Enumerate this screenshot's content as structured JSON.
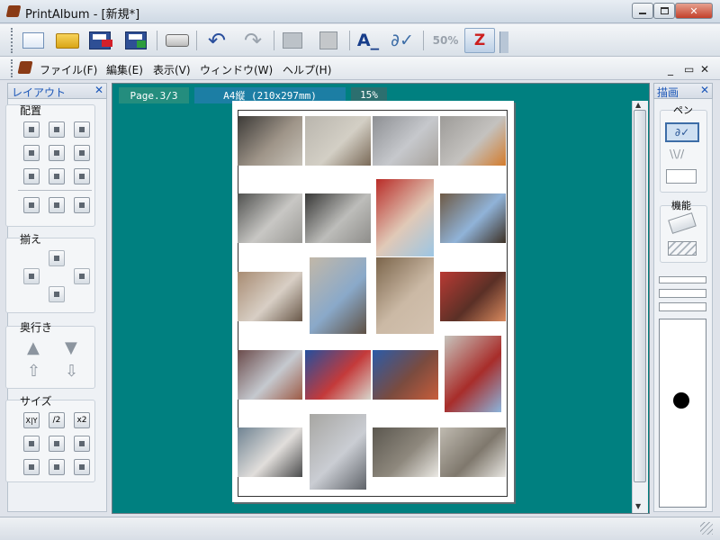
{
  "window": {
    "title": "PrintAlbum - [新規*]",
    "controls": [
      "minimize",
      "maximize",
      "close"
    ]
  },
  "toolbar": {
    "buttons": [
      "new",
      "open",
      "save-as",
      "save",
      "print",
      "undo",
      "redo",
      "copy",
      "paste",
      "text-tool",
      "pen-tool",
      "zoom-50",
      "zoom"
    ],
    "zoom50_label": "50%",
    "zoom_label": "Z"
  },
  "menu": {
    "items": [
      "ファイル(F)",
      "編集(E)",
      "表示(V)",
      "ウィンドウ(W)",
      "ヘルプ(H)"
    ]
  },
  "left_panel": {
    "title": "レイアウト",
    "close": "✕",
    "sections": {
      "align": "配置",
      "match": "揃え",
      "depth": "奥行き",
      "size": "サイズ"
    },
    "size_buttons": {
      "x_y": "X|Y",
      "half": "/2",
      "double": "x2"
    }
  },
  "canvas": {
    "page_tab": "Page.3/3",
    "paper_tab": "A4縦 (210x297mm)",
    "zoom_tab": "15%",
    "photos": [
      {
        "colors": [
          "#3c3a37",
          "#9e9488",
          "#c7c2b8"
        ]
      },
      {
        "colors": [
          "#b9b5ad",
          "#d3cfc5",
          "#7a6a58"
        ]
      },
      {
        "colors": [
          "#8d8f93",
          "#c6c8cc",
          "#a6a19b"
        ]
      },
      {
        "colors": [
          "#9d9b98",
          "#c4c2bf",
          "#d37b2c"
        ]
      },
      {
        "colors": [
          "#50514f",
          "#c8c7c4",
          "#9b9a96"
        ]
      },
      {
        "colors": [
          "#383837",
          "#bdbdba",
          "#8e8d8a"
        ]
      },
      {
        "colors": [
          "#b92c28",
          "#e0c9b7",
          "#9cc6e4"
        ]
      },
      {
        "colors": [
          "#6e5a45",
          "#90b3d8",
          "#3c3024"
        ]
      },
      {
        "colors": [
          "#a88b72",
          "#d8cfc5",
          "#695849"
        ]
      },
      {
        "colors": [
          "#c2b8a8",
          "#8aa9c9",
          "#5e5044"
        ]
      },
      {
        "colors": [
          "#7b654b",
          "#cbb9a5",
          "#d3c2b0"
        ]
      },
      {
        "colors": [
          "#b93a34",
          "#5a3026",
          "#d98a5f"
        ]
      },
      {
        "colors": [
          "#6b4b4b",
          "#c5c9cf",
          "#9d5a45"
        ]
      },
      {
        "colors": [
          "#244f9e",
          "#c43a3a",
          "#d7d5cc"
        ]
      },
      {
        "colors": [
          "#2b5ba8",
          "#7a4b3f",
          "#c85d3b"
        ]
      },
      {
        "colors": [
          "#c7c4bd",
          "#a82d2a",
          "#8bb4dc"
        ]
      },
      {
        "colors": [
          "#6f8392",
          "#e1dedb",
          "#4a4b4c"
        ]
      },
      {
        "colors": [
          "#a7a6a2",
          "#cacdd3",
          "#5f6369"
        ]
      },
      {
        "colors": [
          "#5b574f",
          "#8e887d",
          "#ebe9e4"
        ]
      },
      {
        "colors": [
          "#bfbab0",
          "#7f786d",
          "#e8e6e1"
        ]
      }
    ]
  },
  "right_panel": {
    "title": "描画",
    "close": "✕",
    "pen_label": "ペン",
    "function_label": "機能"
  }
}
